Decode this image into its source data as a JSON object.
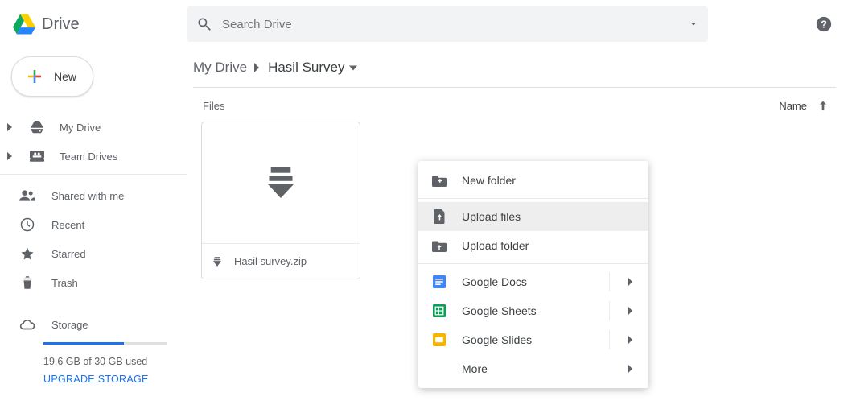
{
  "brand": {
    "name": "Drive"
  },
  "search": {
    "placeholder": "Search Drive"
  },
  "sidebar": {
    "new_label": "New",
    "items": [
      {
        "label": "My Drive"
      },
      {
        "label": "Team Drives"
      },
      {
        "label": "Shared with me"
      },
      {
        "label": "Recent"
      },
      {
        "label": "Starred"
      },
      {
        "label": "Trash"
      },
      {
        "label": "Storage"
      }
    ],
    "storage": {
      "text": "19.6 GB of 30 GB used",
      "upgrade": "UPGRADE STORAGE"
    }
  },
  "breadcrumb": {
    "root": "My Drive",
    "current": "Hasil Survey"
  },
  "section": {
    "label": "Files"
  },
  "sort": {
    "field": "Name"
  },
  "files": [
    {
      "name": "Hasil survey.zip"
    }
  ],
  "context_menu": {
    "new_folder": "New folder",
    "upload_files": "Upload files",
    "upload_folder": "Upload folder",
    "docs": "Google Docs",
    "sheets": "Google Sheets",
    "slides": "Google Slides",
    "more": "More"
  }
}
